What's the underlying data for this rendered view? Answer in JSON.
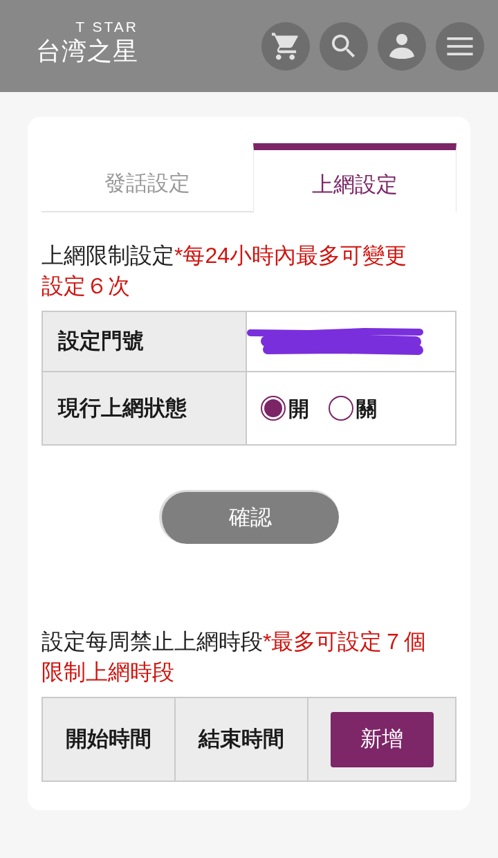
{
  "header": {
    "logo": {
      "tagline": "T STAR",
      "name": "台湾之星"
    }
  },
  "tabs": [
    {
      "label": "發話設定",
      "selected": false
    },
    {
      "label": "上網設定",
      "selected": true
    }
  ],
  "limit_section": {
    "title": "上網限制設定",
    "note": "*每24小時內最多可變更設定６次",
    "rows": [
      {
        "kind": "number",
        "label": "設定門號",
        "redacted": true
      },
      {
        "kind": "radio",
        "label": "現行上網狀態",
        "options": [
          {
            "label": "開",
            "selected": true
          },
          {
            "label": "關",
            "selected": false
          }
        ]
      }
    ],
    "confirm_button": "確認"
  },
  "schedule_section": {
    "title": "設定每周禁止上網時段",
    "note": "*最多可設定７個限制上網時段",
    "columns": [
      "開始時間",
      "結束時間"
    ],
    "add_button": "新增"
  }
}
